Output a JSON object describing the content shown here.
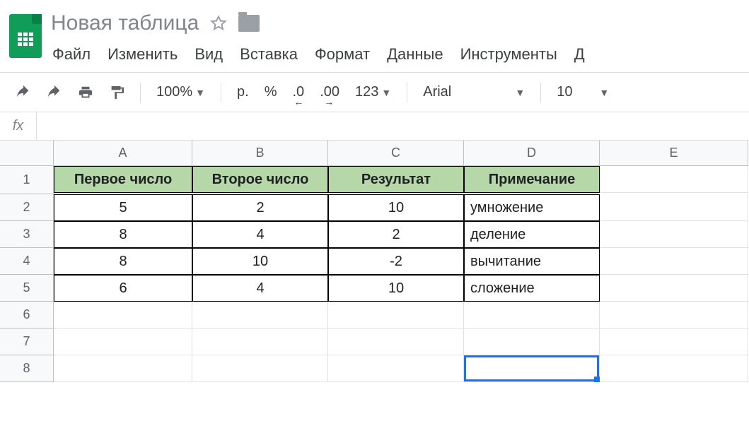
{
  "doc_title": "Новая таблица",
  "menu": {
    "file": "Файл",
    "edit": "Изменить",
    "view": "Вид",
    "insert": "Вставка",
    "format": "Формат",
    "data": "Данные",
    "tools": "Инструменты",
    "more": "Д"
  },
  "toolbar": {
    "zoom": "100%",
    "currency": "р.",
    "percent": "%",
    "dec_less": ".0",
    "dec_more": ".00",
    "num_format": "123",
    "font": "Arial",
    "font_size": "10"
  },
  "fx_label": "fx",
  "fx_value": "",
  "columns": [
    "A",
    "B",
    "C",
    "D",
    "E"
  ],
  "row_numbers": [
    "1",
    "2",
    "3",
    "4",
    "5",
    "6",
    "7",
    "8"
  ],
  "headers": {
    "A": "Первое число",
    "B": "Второе число",
    "C": "Результат",
    "D": "Примечание"
  },
  "data_rows": [
    {
      "A": "5",
      "B": "2",
      "C": "10",
      "D": "умножение"
    },
    {
      "A": "8",
      "B": "4",
      "C": "2",
      "D": "деление"
    },
    {
      "A": "8",
      "B": "10",
      "C": "-2",
      "D": "вычитание"
    },
    {
      "A": "6",
      "B": "4",
      "C": "10",
      "D": "сложение"
    }
  ],
  "selected_cell": "D8"
}
